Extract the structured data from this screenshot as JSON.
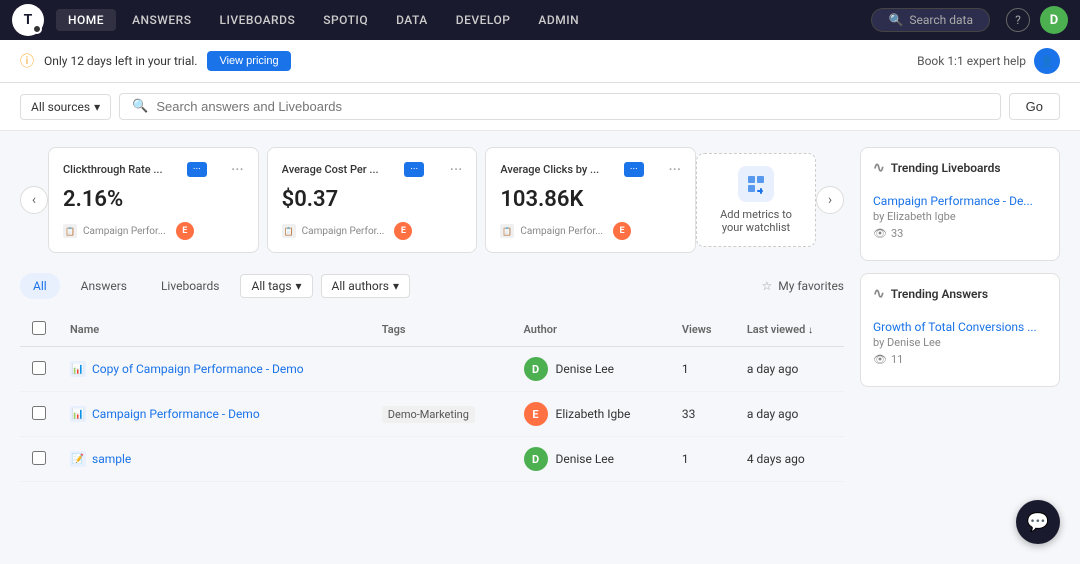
{
  "nav": {
    "logo_text": "T",
    "items": [
      {
        "label": "HOME",
        "active": true
      },
      {
        "label": "ANSWERS",
        "active": false
      },
      {
        "label": "LIVEBOARDS",
        "active": false
      },
      {
        "label": "SPOTIQ",
        "active": false
      },
      {
        "label": "DATA",
        "active": false
      },
      {
        "label": "DEVELOP",
        "active": false
      },
      {
        "label": "ADMIN",
        "active": false
      }
    ],
    "search_placeholder": "Search data",
    "help_label": "?",
    "avatar_label": "D"
  },
  "trial_banner": {
    "message": "Only 12 days left in your trial.",
    "button_label": "View pricing",
    "expert_help_label": "Book 1:1 expert help"
  },
  "search_bar": {
    "sources_label": "All sources",
    "placeholder": "Search answers and Liveboards",
    "go_label": "Go"
  },
  "metrics": {
    "cards": [
      {
        "title": "Clickthrough Rate ...",
        "badge": true,
        "value": "2.16%",
        "source": "Campaign Perfor...",
        "author_initial": "E",
        "more": true
      },
      {
        "title": "Average Cost Per ...",
        "badge": true,
        "value": "$0.37",
        "source": "Campaign Perfor...",
        "author_initial": "E",
        "more": true
      },
      {
        "title": "Average Clicks by ...",
        "badge": true,
        "value": "103.86K",
        "source": "Campaign Perfor...",
        "author_initial": "E",
        "more": true
      }
    ],
    "add_card": {
      "text": "Add metrics to your watchlist"
    }
  },
  "filters": {
    "tabs": [
      {
        "label": "All",
        "active": true
      },
      {
        "label": "Answers",
        "active": false
      },
      {
        "label": "Liveboards",
        "active": false
      }
    ],
    "tags_label": "All tags",
    "authors_label": "All authors",
    "favorites_label": "My favorites"
  },
  "table": {
    "columns": [
      "Name",
      "Tags",
      "Author",
      "Views",
      "Last viewed"
    ],
    "rows": [
      {
        "name": "Copy of Campaign Performance - Demo",
        "tags": "",
        "author_name": "Denise Lee",
        "author_initial": "D",
        "author_color": "#4CAF50",
        "views": "1",
        "last_viewed": "a day ago",
        "type": "liveboard"
      },
      {
        "name": "Campaign Performance - Demo",
        "tags": "Demo-Marketing",
        "author_name": "Elizabeth Igbe",
        "author_initial": "E",
        "author_color": "#FF7043",
        "views": "33",
        "last_viewed": "a day ago",
        "type": "liveboard"
      },
      {
        "name": "sample",
        "tags": "",
        "author_name": "Denise Lee",
        "author_initial": "D",
        "author_color": "#4CAF50",
        "views": "1",
        "last_viewed": "4 days ago",
        "type": "answer"
      }
    ]
  },
  "trending": {
    "liveboards": {
      "header": "Trending Liveboards",
      "items": [
        {
          "title": "Campaign Performance - De...",
          "by": "by Elizabeth Igbe",
          "views": "33"
        }
      ]
    },
    "answers": {
      "header": "Trending Answers",
      "items": [
        {
          "title": "Growth of Total Conversions ...",
          "by": "by Denise Lee",
          "views": "11"
        }
      ]
    }
  }
}
